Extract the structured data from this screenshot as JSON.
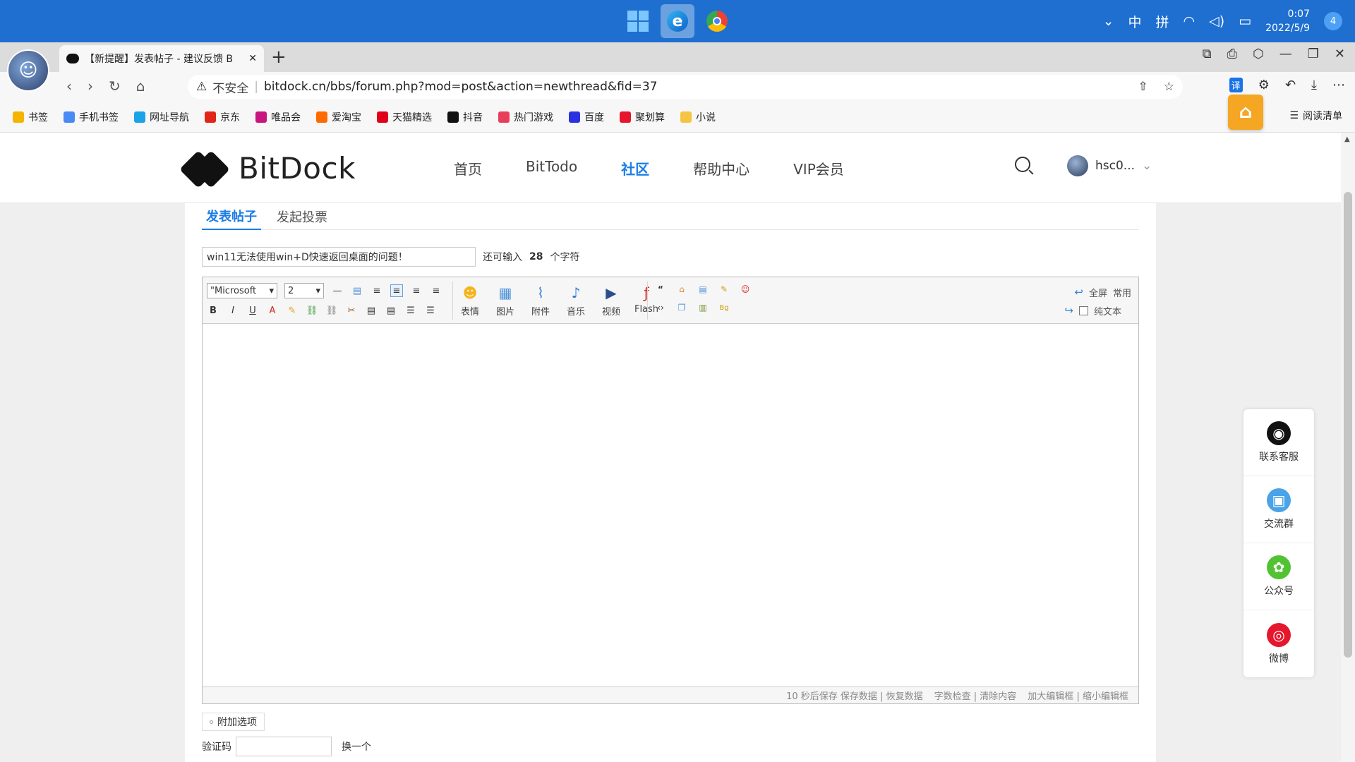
{
  "taskbar": {
    "tray_symbols": {
      "chevron": "⌄",
      "ime_mode": "中",
      "ime_pinyin": "拼",
      "wifi": "◠",
      "volume": "◁)",
      "battery": "▭"
    },
    "time": "0:07",
    "date": "2022/5/9",
    "notifications": "4",
    "apps": [
      "windows-start",
      "edge",
      "chrome"
    ]
  },
  "browser": {
    "tab_title": "【新提醒】发表帖子 - 建议反馈 B",
    "tab_close": "✕",
    "new_tab": "+",
    "window_controls": [
      "⧉",
      "⎙",
      "⬡",
      "—",
      "❐",
      "✕"
    ],
    "nav": [
      "‹",
      "›",
      "↻",
      "⌂"
    ],
    "insecure_label": "不安全",
    "url": "bitdock.cn/bbs/forum.php?mod=post&action=newthread&fid=37",
    "url_icons": [
      "⇧",
      "☆"
    ],
    "right_icons": {
      "translate": "译",
      "extensions": "⚙",
      "undo": "↶",
      "download": "⤓",
      "more": "⋯"
    },
    "reading_list": "阅读清单",
    "reading_icon": "☰",
    "ext_badge": "⌂",
    "bookmarks": [
      {
        "label": "书签",
        "color": "#f4b400"
      },
      {
        "label": "手机书签",
        "color": "#4a8af4"
      },
      {
        "label": "网址导航",
        "color": "#1aa3e8"
      },
      {
        "label": "京东",
        "color": "#e1251b"
      },
      {
        "label": "唯品会",
        "color": "#c9157e"
      },
      {
        "label": "爱淘宝",
        "color": "#ff6a00"
      },
      {
        "label": "天猫精选",
        "color": "#e0001b"
      },
      {
        "label": "抖音",
        "color": "#111111"
      },
      {
        "label": "热门游戏",
        "color": "#e83e5a"
      },
      {
        "label": "百度",
        "color": "#2932e1"
      },
      {
        "label": "聚划算",
        "color": "#e6162d"
      },
      {
        "label": "小说",
        "color": "#f4c542"
      }
    ]
  },
  "site": {
    "logo_text": "BitDock",
    "nav": [
      {
        "label": "首页",
        "active": false
      },
      {
        "label": "BitTodo",
        "active": false
      },
      {
        "label": "社区",
        "active": true
      },
      {
        "label": "帮助中心",
        "active": false
      },
      {
        "label": "VIP会员",
        "active": false
      }
    ],
    "user_name": "hsc0...",
    "user_chevron": "⌄"
  },
  "post": {
    "tabs": [
      {
        "label": "发表帖子",
        "active": true
      },
      {
        "label": "发起投票",
        "active": false
      }
    ],
    "title_value": "win11无法使用win+D快速返回桌面的问题！",
    "remaining_prefix": "还可输入",
    "remaining_count": "28",
    "remaining_suffix": "个字符",
    "font_select": "\"Microsoft",
    "size_select": "2",
    "big_tools": [
      {
        "label": "表情",
        "icon": "☻",
        "color": "#f5b51a"
      },
      {
        "label": "图片",
        "icon": "▦",
        "color": "#4a90d9"
      },
      {
        "label": "附件",
        "icon": "⌇",
        "color": "#3b86d8"
      },
      {
        "label": "音乐",
        "icon": "♪",
        "color": "#2b7ad6"
      },
      {
        "label": "视频",
        "icon": "▶",
        "color": "#2a4f8a"
      },
      {
        "label": "Flash",
        "icon": "ƒ",
        "color": "#d9251d"
      }
    ],
    "toolbar_glyphs": {
      "row1": [
        "—",
        "▤",
        "≡",
        "≡",
        "≡",
        "≡"
      ],
      "row2": [
        "B",
        "I",
        "U",
        "A",
        "✎",
        "⛓",
        "⛓",
        "✂",
        "▤",
        "▤",
        "☰",
        "☰"
      ],
      "small_grid": [
        "“",
        "⌂",
        "▤",
        "✎",
        "☺",
        "‹›",
        "❐",
        "▥",
        "Bg"
      ]
    },
    "fullscreen": "全屏",
    "common": "常用",
    "plaintext": "纯文本",
    "arrows": {
      "undo": "↩",
      "redo": "↪"
    },
    "select_caret": "▾",
    "status": {
      "autosave": "10 秒后保存",
      "save": "保存数据",
      "restore": "恢复数据",
      "wordcheck": "字数检查",
      "clear": "清除内容",
      "enlarge": "加大编辑框",
      "shrink": "缩小编辑框",
      "sep": "|"
    },
    "extra_options": "附加选项",
    "captcha_label": "验证码",
    "captcha_swap": "换一个"
  },
  "float_panel": [
    {
      "label": "联系客服",
      "icon": "◉",
      "color": "#111111"
    },
    {
      "label": "交流群",
      "icon": "▣",
      "color": "#4aa3e8"
    },
    {
      "label": "公众号",
      "icon": "✿",
      "color": "#51c332"
    },
    {
      "label": "微博",
      "icon": "◎",
      "color": "#e6162d"
    }
  ]
}
